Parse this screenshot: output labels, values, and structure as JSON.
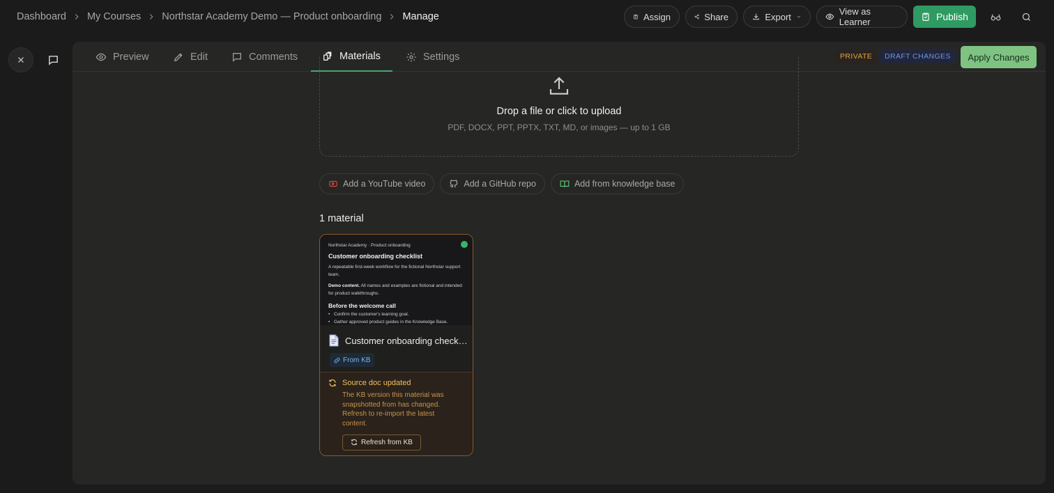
{
  "breadcrumb": {
    "items": [
      "Dashboard",
      "My Courses",
      "Northstar Academy Demo — Product onboarding"
    ],
    "current": "Manage"
  },
  "top_actions": {
    "assign": "Assign",
    "share": "Share",
    "export": "Export",
    "view_as_learner": "View as Learner",
    "publish": "Publish"
  },
  "tabs": [
    {
      "label": "Preview",
      "icon": "eye-icon"
    },
    {
      "label": "Edit",
      "icon": "pencil-icon"
    },
    {
      "label": "Comments",
      "icon": "comment-icon"
    },
    {
      "label": "Materials",
      "icon": "materials-icon",
      "active": true
    },
    {
      "label": "Settings",
      "icon": "gear-icon"
    }
  ],
  "status": {
    "private": "PRIVATE",
    "draft": "DRAFT CHANGES",
    "apply": "Apply Changes"
  },
  "upload": {
    "title": "Drop a file or click to upload",
    "subtitle": "PDF, DOCX, PPT, PPTX, TXT, MD, or images — up to 1 GB"
  },
  "sources": {
    "youtube": "Add a YouTube video",
    "github": "Add a GitHub repo",
    "knowledge_base": "Add from knowledge base"
  },
  "materials": {
    "count_label": "1 material",
    "items": [
      {
        "preview": {
          "kicker": "Northstar Academy · Product onboarding",
          "title": "Customer onboarding checklist",
          "intro": "A repeatable first-week workflow for the fictional Northstar support team.",
          "demo_label": "Demo content.",
          "demo_text": "All names and examples are fictional and intended for product walkthroughs.",
          "section": "Before the welcome call",
          "bullets": [
            "Confirm the customer's learning goal.",
            "Gather approved product guides in the Knowledge Base."
          ]
        },
        "name": "Customer onboarding checklist",
        "origin": "From KB",
        "warning": {
          "title": "Source doc updated",
          "body": "The KB version this material was snapshotted from has changed. Refresh to re-import the latest content.",
          "action": "Refresh from KB"
        }
      }
    ]
  },
  "colors": {
    "accent_green": "#2f9a61",
    "tab_underline": "#4aa672",
    "warning_orange": "#f2c15d",
    "private_orange": "#e8a23b",
    "draft_blue": "#6f93e8"
  }
}
